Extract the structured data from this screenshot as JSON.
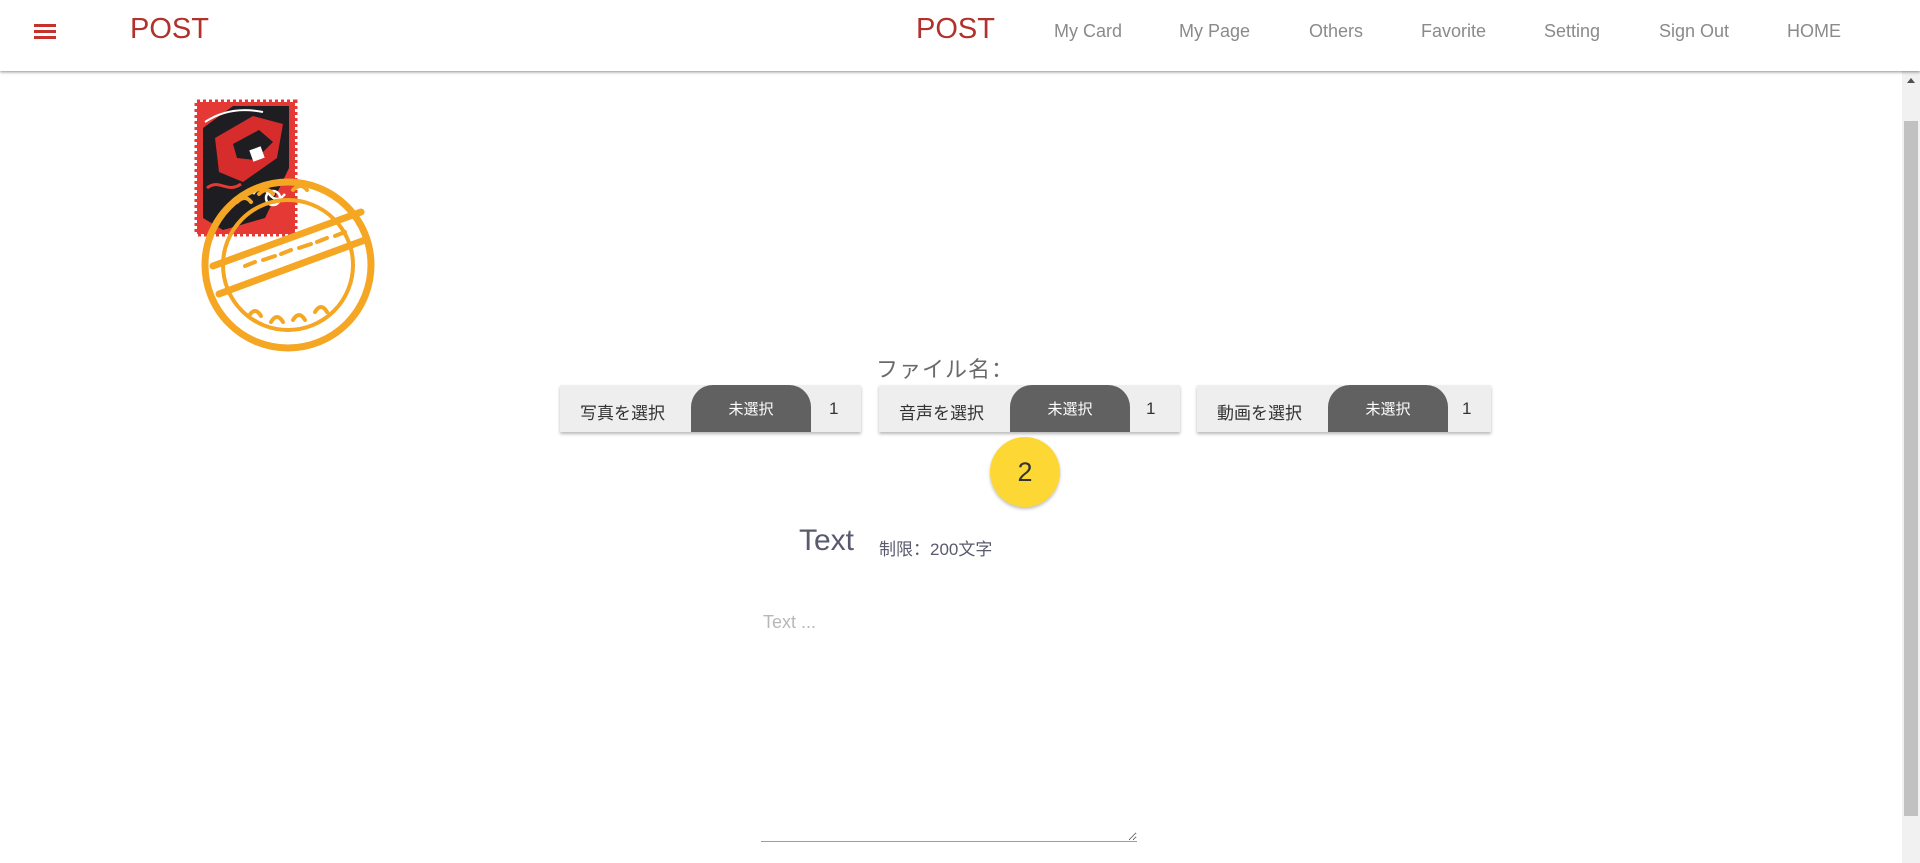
{
  "header": {
    "brand_left": "POST",
    "brand_right": "POST",
    "nav": [
      "My Card",
      "My Page",
      "Others",
      "Favorite",
      "Setting",
      "Sign Out",
      "HOME"
    ]
  },
  "file_section": {
    "file_name_label": "ファイル名：",
    "pickers": [
      {
        "label": "写真を選択",
        "status": "未選択",
        "count": "1"
      },
      {
        "label": "音声を選択",
        "status": "未選択",
        "count": "1"
      },
      {
        "label": "動画を選択",
        "status": "未選択",
        "count": "1"
      }
    ],
    "step_badge": "2"
  },
  "text_section": {
    "title": "Text",
    "limit": "制限：200文字",
    "placeholder": "Text ..."
  },
  "colors": {
    "brand_red": "#b3312d",
    "badge_yellow": "#fdd835",
    "pill_gray": "#616161",
    "stamp_red": "#e53935",
    "stamp_orange": "#f5a623"
  },
  "icons": {
    "menu": "hamburger-menu-icon",
    "logo": "stamp-logo"
  }
}
